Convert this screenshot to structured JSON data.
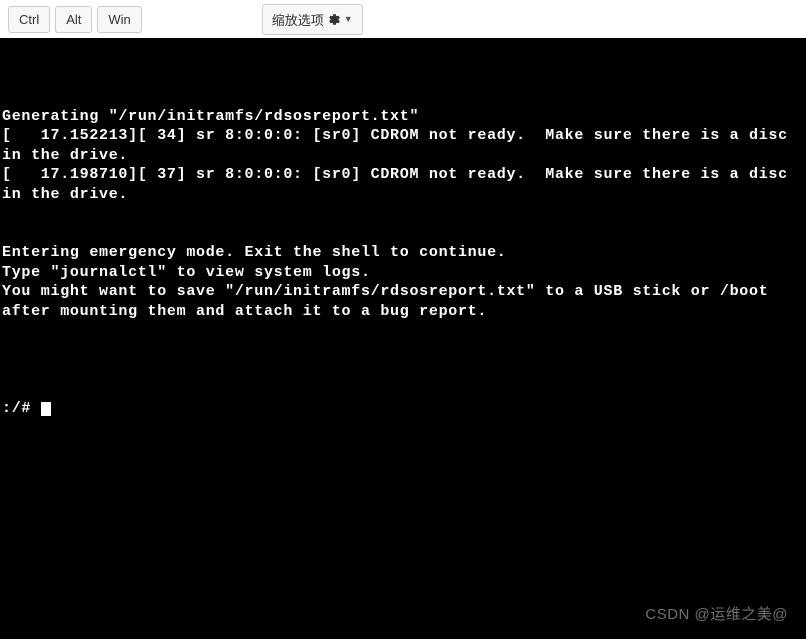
{
  "toolbar": {
    "ctrl": "Ctrl",
    "alt": "Alt",
    "win": "Win",
    "zoom_label": "缩放选项"
  },
  "terminal": {
    "lines": [
      "",
      "Generating \"/run/initramfs/rdsosreport.txt\"",
      "[   17.152213][ 34] sr 8:0:0:0: [sr0] CDROM not ready.  Make sure there is a disc in the drive.",
      "[   17.198710][ 37] sr 8:0:0:0: [sr0] CDROM not ready.  Make sure there is a disc in the drive.",
      "",
      "",
      "Entering emergency mode. Exit the shell to continue.",
      "Type \"journalctl\" to view system logs.",
      "You might want to save \"/run/initramfs/rdsosreport.txt\" to a USB stick or /boot",
      "after mounting them and attach it to a bug report.",
      "",
      ""
    ],
    "prompt": ":/# "
  },
  "watermark": "CSDN @运维之美@"
}
